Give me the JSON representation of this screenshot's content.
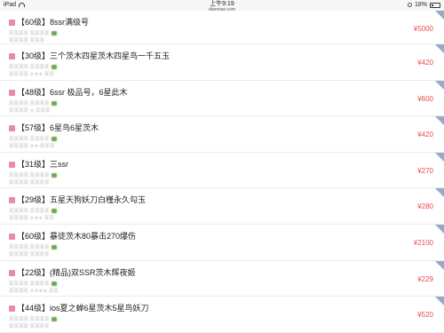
{
  "status": {
    "device": "iPad",
    "time": "上午9:19",
    "url": "dianmao.com",
    "battery": "18%"
  },
  "listings": [
    {
      "title": "【60级】8ssr满级号",
      "sub1": "某某某某 某某某某",
      "sub2": "某某某某  某某某",
      "stars": "",
      "price": "¥5000"
    },
    {
      "title": "【30级】三个茨木四星茨木四星鸟一千五玉",
      "sub1": "某某某某 某某某某",
      "sub2": "某某某某 ★★★ 某某",
      "stars": "★★★",
      "price": "¥420"
    },
    {
      "title": "【48级】6ssr 极品号，6星此木",
      "sub1": "某某某某 某某某某",
      "sub2": "某某某某 ★ 某某某",
      "stars": "★",
      "price": "¥600"
    },
    {
      "title": "【57级】6星鸟6星茨木",
      "sub1": "某某某某 某某某某",
      "sub2": "某某某某 ★★ 某某某",
      "stars": "★★",
      "price": "¥420"
    },
    {
      "title": "【31级】三ssr",
      "sub1": "某某某某 某某某某",
      "sub2": "某某某某 某某某某",
      "stars": "",
      "price": "¥270"
    },
    {
      "title": "【29级】五星天狗妖刀白槿永久勾玉",
      "sub1": "某某某某 某某某某",
      "sub2": "某某某某 ★★★ 某某",
      "stars": "★★★",
      "price": "¥280"
    },
    {
      "title": "【60级】暴徒茨木80暴击270爆伤",
      "sub1": "某某某某 某某某某",
      "sub2": "某某某某 某某某某",
      "stars": "",
      "price": "¥2100"
    },
    {
      "title": "【22级】(精品)双SSR茨木辉夜姬",
      "sub1": "某某某某 某某某某",
      "sub2": "某某某某 ★★★★ 某某",
      "stars": "★★★★",
      "price": "¥229"
    },
    {
      "title": "【44级】ios夏之蝉6星茨木5星鸟妖刀",
      "sub1": "某某某某 某某某某",
      "sub2": "某某某某 某某某某",
      "stars": "",
      "price": "¥520"
    }
  ]
}
